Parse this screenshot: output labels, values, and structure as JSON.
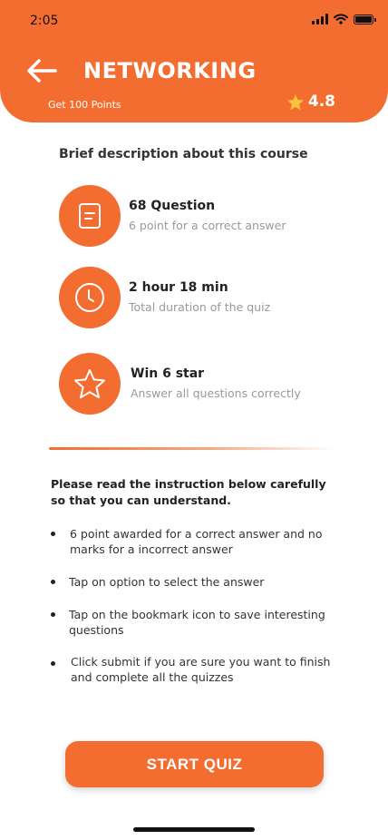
{
  "status_bar": {
    "time": "2:05"
  },
  "header": {
    "title": "NETWORKING",
    "points": "Get 100 Points",
    "rating": "4.8",
    "accent_color": "#F36D31"
  },
  "description": {
    "heading": "Brief description about this course",
    "features": [
      {
        "icon": "document-icon",
        "title": "68 Question",
        "subtitle": "6 point for a correct answer"
      },
      {
        "icon": "clock-icon",
        "title": "2 hour 18 min",
        "subtitle": "Total duration of the quiz"
      },
      {
        "icon": "star-outline-icon",
        "title": "Win 6 star",
        "subtitle": "Answer all questions correctly"
      }
    ]
  },
  "instructions": {
    "heading": "Please read the instruction below carefully so that you can understand.",
    "items": [
      "6 point awarded for a correct answer and no marks for a incorrect answer",
      "Tap on option to select the answer",
      "Tap on the bookmark icon to save interesting questions",
      "Click submit if you are sure you want to finish and complete all the quizzes"
    ]
  },
  "actions": {
    "start_label": "START QUIZ"
  }
}
